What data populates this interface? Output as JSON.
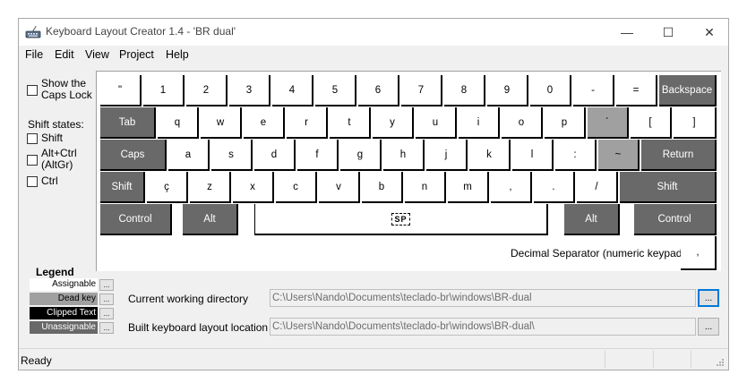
{
  "window": {
    "title": "Keyboard Layout Creator 1.4 - 'BR dual'",
    "controls": {
      "minimize": "—",
      "maximize": "☐",
      "close": "✕"
    }
  },
  "menu": {
    "file": "File",
    "edit": "Edit",
    "view": "View",
    "project": "Project",
    "help": "Help"
  },
  "options": {
    "show_caps_lock": "Show the\nCaps Lock",
    "shift_states_title": "Shift states:",
    "shift": "Shift",
    "altgr": "Alt+Ctrl\n(AltGr)",
    "ctrl": "Ctrl"
  },
  "keyboard": {
    "row1": [
      "\"",
      "1",
      "2",
      "3",
      "4",
      "5",
      "6",
      "7",
      "8",
      "9",
      "0",
      "-",
      "=",
      "Backspace"
    ],
    "row2": [
      "Tab",
      "q",
      "w",
      "e",
      "r",
      "t",
      "y",
      "u",
      "i",
      "o",
      "p",
      "´",
      "[",
      "]"
    ],
    "row3": [
      "Caps",
      "a",
      "s",
      "d",
      "f",
      "g",
      "h",
      "j",
      "k",
      "l",
      ":",
      "~",
      "Return"
    ],
    "row4": [
      "Shift",
      "ç",
      "z",
      "x",
      "c",
      "v",
      "b",
      "n",
      "m",
      ",",
      ".",
      "/",
      "Shift"
    ],
    "row5": [
      "Control",
      "Alt",
      "SP",
      "Alt",
      "Control"
    ],
    "decimal_separator_label": "Decimal Separator (numeric keypad)",
    "decimal_key": ","
  },
  "legend": {
    "title": "Legend",
    "assignable": "Assignable",
    "dead_key": "Dead key",
    "clipped_text": "Clipped Text",
    "unassignable": "Unassignable",
    "button": "...",
    "colors": {
      "assignable": "#ffffff",
      "dead_key": "#a0a0a0",
      "clipped_text": "#000000",
      "unassignable": "#696969"
    }
  },
  "paths": {
    "cwd_label": "Current working directory",
    "cwd_value": "C:\\Users\\Nando\\Documents\\teclado-br\\windows\\BR-dual",
    "build_label": "Built keyboard layout location",
    "build_value": "C:\\Users\\Nando\\Documents\\teclado-br\\windows\\BR-dual\\",
    "browse": "..."
  },
  "status": {
    "text": "Ready"
  }
}
